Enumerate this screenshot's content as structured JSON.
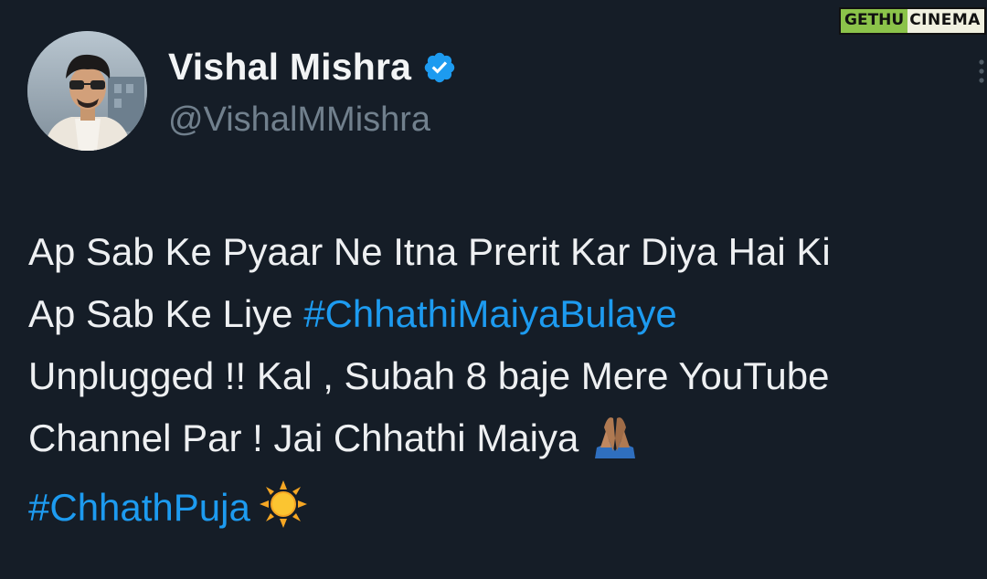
{
  "watermark": {
    "part1": "GETHU",
    "part2": "CINEMA"
  },
  "author": {
    "name": "Vishal Mishra",
    "handle": "@VishalMMishra",
    "verified": true,
    "verified_color": "#1d9bf0"
  },
  "tweet": {
    "line1": "Ap Sab Ke Pyaar Ne Itna Prerit Kar Diya Hai Ki",
    "line2_text": "Ap Sab Ke Liye ",
    "line2_hashtag": "#ChhathiMaiyaBulaye",
    "line3": "Unplugged !! Kal , Subah 8 baje Mere YouTube",
    "line4": "Channel Par ! Jai Chhathi Maiya",
    "line4_emoji": "folded-hands-emoji",
    "line5_hashtag": "#ChhathPuja",
    "line5_emoji": "sun-emoji"
  },
  "colors": {
    "background": "#151d27",
    "link": "#1d9bf0",
    "handle": "#71808d"
  }
}
